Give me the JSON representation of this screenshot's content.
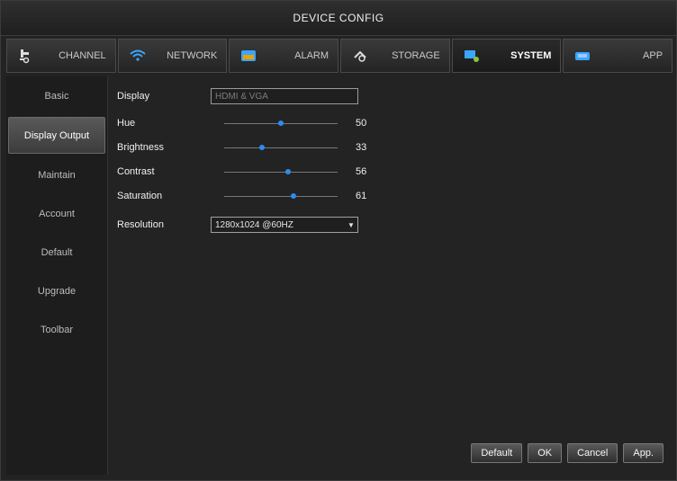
{
  "window": {
    "title": "DEVICE CONFIG"
  },
  "tabs": [
    {
      "label": "CHANNEL",
      "icon": "camera-icon"
    },
    {
      "label": "NETWORK",
      "icon": "wifi-icon"
    },
    {
      "label": "ALARM",
      "icon": "alarm-icon"
    },
    {
      "label": "STORAGE",
      "icon": "storage-icon"
    },
    {
      "label": "SYSTEM",
      "icon": "system-icon",
      "active": true
    },
    {
      "label": "APP",
      "icon": "app-icon"
    }
  ],
  "sidebar": {
    "items": [
      {
        "label": "Basic"
      },
      {
        "label": "Display Output",
        "active": true
      },
      {
        "label": "Maintain"
      },
      {
        "label": "Account"
      },
      {
        "label": "Default"
      },
      {
        "label": "Upgrade"
      },
      {
        "label": "Toolbar"
      }
    ]
  },
  "form": {
    "display": {
      "label": "Display",
      "value": "HDMI & VGA"
    },
    "hue": {
      "label": "Hue",
      "value": "50",
      "level": 0.5
    },
    "brightness": {
      "label": "Brightness",
      "value": "33",
      "level": 0.33
    },
    "contrast": {
      "label": "Contrast",
      "value": "56",
      "level": 0.56
    },
    "saturation": {
      "label": "Saturation",
      "value": "61",
      "level": 0.61
    },
    "resolution": {
      "label": "Resolution",
      "value": "1280x1024 @60HZ"
    }
  },
  "buttons": {
    "default": "Default",
    "ok": "OK",
    "cancel": "Cancel",
    "apply": "App."
  },
  "colors": {
    "accent": "#2e8cf0",
    "background": "#232323"
  }
}
